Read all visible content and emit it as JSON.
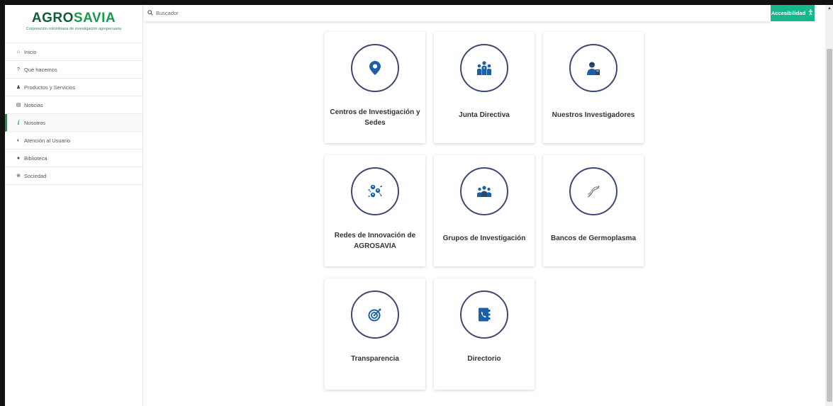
{
  "brand": {
    "logo_text_left": "AGRO",
    "logo_text_right": "SAVIA",
    "tagline": "Corporación colombiana de investigación agropecuaria"
  },
  "sidebar": {
    "items": [
      {
        "label": "Inicio",
        "icon": "home-icon",
        "glyph": "⌂"
      },
      {
        "label": "Qué hacemos",
        "icon": "question-icon",
        "glyph": "?"
      },
      {
        "label": "Productos y Servicios",
        "icon": "person-icon",
        "glyph": "♟"
      },
      {
        "label": "Noticias",
        "icon": "newspaper-icon",
        "glyph": "▤"
      },
      {
        "label": "Nosotros",
        "icon": "info-icon",
        "glyph": "i",
        "active": true
      },
      {
        "label": "Atención al Usuario",
        "icon": "users-icon",
        "glyph": "◐"
      },
      {
        "label": "Biblioteca",
        "icon": "book-icon",
        "glyph": "●"
      },
      {
        "label": "Sociedad",
        "icon": "globe-icon",
        "glyph": "⊕"
      }
    ]
  },
  "search": {
    "placeholder": "Buscador"
  },
  "accessibility": {
    "label": "Accesibilidad",
    "icon": "accessibility-icon"
  },
  "cards": [
    {
      "label": "Centros de Investigación y Sedes",
      "icon": "map-pin-icon"
    },
    {
      "label": "Junta Directiva",
      "icon": "board-icon"
    },
    {
      "label": "Nuestros Investigadores",
      "icon": "researcher-icon"
    },
    {
      "label": "Redes de Innovación de AGROSAVIA",
      "icon": "network-icon"
    },
    {
      "label": "Grupos de Investigación",
      "icon": "group-icon"
    },
    {
      "label": "Bancos de Germoplasma",
      "icon": "dna-icon"
    },
    {
      "label": "Transparencia",
      "icon": "target-icon"
    },
    {
      "label": "Directorio",
      "icon": "phonebook-icon"
    }
  ],
  "colors": {
    "brand_green": "#1a9a4b",
    "accent_teal": "#17b68b",
    "icon_blue": "#1b5fa8",
    "circle_border": "#3e4872"
  }
}
